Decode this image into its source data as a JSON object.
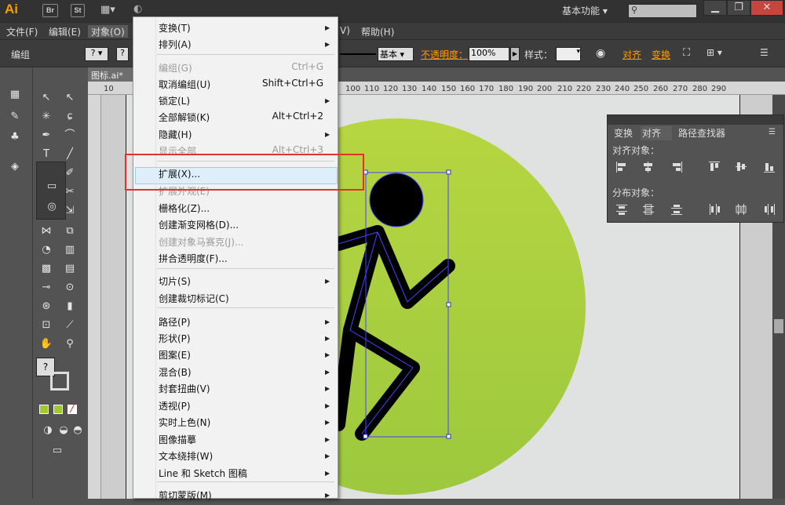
{
  "app": {
    "logo": "Ai",
    "br_label": "Br",
    "st_label": "St",
    "workspace": "基本功能",
    "doc_tab": "图标.ai*"
  },
  "menubar": [
    "文件(F)",
    "编辑(E)",
    "对象(O)",
    "V)",
    "帮助(H)"
  ],
  "controlbar": {
    "selection_label": "编组",
    "stroke_style": "基本",
    "opacity_label": "不透明度：",
    "opacity_value": "100%",
    "style_label": "样式：",
    "align_link": "对齐",
    "transform_link": "变换"
  },
  "ruler_ticks": [
    "10",
    "100",
    "110",
    "120",
    "130",
    "140",
    "150",
    "160",
    "170",
    "180",
    "190",
    "200",
    "210",
    "220",
    "230",
    "240",
    "250",
    "260",
    "270",
    "280",
    "290"
  ],
  "align_panel": {
    "tabs": [
      "变换",
      "对齐",
      "路径查找器"
    ],
    "align_objects_label": "对齐对象：",
    "distribute_label": "分布对象："
  },
  "menu": {
    "items": [
      {
        "label": "变换(T)",
        "shortcut": "",
        "submenu": true,
        "disabled": false
      },
      {
        "label": "排列(A)",
        "shortcut": "",
        "submenu": true,
        "disabled": false
      },
      {
        "label": "编组(G)",
        "shortcut": "Ctrl+G",
        "submenu": false,
        "disabled": true
      },
      {
        "label": "取消编组(U)",
        "shortcut": "Shift+Ctrl+G",
        "submenu": false,
        "disabled": false
      },
      {
        "label": "锁定(L)",
        "shortcut": "",
        "submenu": true,
        "disabled": false
      },
      {
        "label": "全部解锁(K)",
        "shortcut": "Alt+Ctrl+2",
        "submenu": false,
        "disabled": false
      },
      {
        "label": "隐藏(H)",
        "shortcut": "",
        "submenu": true,
        "disabled": false
      },
      {
        "label": "显示全部",
        "shortcut": "Alt+Ctrl+3",
        "submenu": false,
        "disabled": true
      },
      {
        "label": "扩展(X)...",
        "shortcut": "",
        "submenu": false,
        "disabled": false
      },
      {
        "label": "扩展外观(E)",
        "shortcut": "",
        "submenu": false,
        "disabled": true
      },
      {
        "label": "栅格化(Z)...",
        "shortcut": "",
        "submenu": false,
        "disabled": false
      },
      {
        "label": "创建渐变网格(D)...",
        "shortcut": "",
        "submenu": false,
        "disabled": false
      },
      {
        "label": "创建对象马赛克(J)...",
        "shortcut": "",
        "submenu": false,
        "disabled": true
      },
      {
        "label": "拼合透明度(F)...",
        "shortcut": "",
        "submenu": false,
        "disabled": false
      },
      {
        "label": "切片(S)",
        "shortcut": "",
        "submenu": true,
        "disabled": false
      },
      {
        "label": "创建裁切标记(C)",
        "shortcut": "",
        "submenu": false,
        "disabled": false
      },
      {
        "label": "路径(P)",
        "shortcut": "",
        "submenu": true,
        "disabled": false
      },
      {
        "label": "形状(P)",
        "shortcut": "",
        "submenu": true,
        "disabled": false
      },
      {
        "label": "图案(E)",
        "shortcut": "",
        "submenu": true,
        "disabled": false
      },
      {
        "label": "混合(B)",
        "shortcut": "",
        "submenu": true,
        "disabled": false
      },
      {
        "label": "封套扭曲(V)",
        "shortcut": "",
        "submenu": true,
        "disabled": false
      },
      {
        "label": "透视(P)",
        "shortcut": "",
        "submenu": true,
        "disabled": false
      },
      {
        "label": "实时上色(N)",
        "shortcut": "",
        "submenu": true,
        "disabled": false
      },
      {
        "label": "图像描摹",
        "shortcut": "",
        "submenu": true,
        "disabled": false
      },
      {
        "label": "文本绕排(W)",
        "shortcut": "",
        "submenu": true,
        "disabled": false
      },
      {
        "label": "Line 和 Sketch 图稿",
        "shortcut": "",
        "submenu": true,
        "disabled": false
      },
      {
        "label": "剪切蒙版(M)",
        "shortcut": "",
        "submenu": true,
        "disabled": false
      }
    ]
  },
  "colors": {
    "menu_bg": "#f2f2f2",
    "highlight": "#dfeefb",
    "red_box": "#e8302a",
    "circle_green": "#aed041"
  }
}
